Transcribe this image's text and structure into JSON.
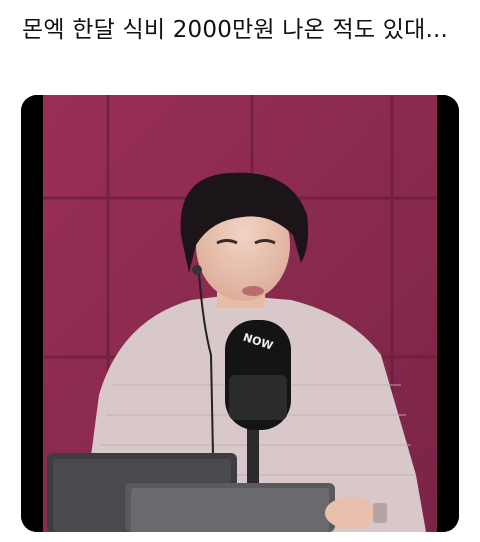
{
  "post": {
    "text": "몬엑 한달 식비 2000만원 나온 적도 있대...",
    "media": {
      "mic_brand": "NOW",
      "colors": {
        "wall": "#8c2a4f",
        "wall_dark": "#6a1d3a",
        "shirt": "#d9c9cb",
        "hair": "#1b1418"
      }
    }
  }
}
